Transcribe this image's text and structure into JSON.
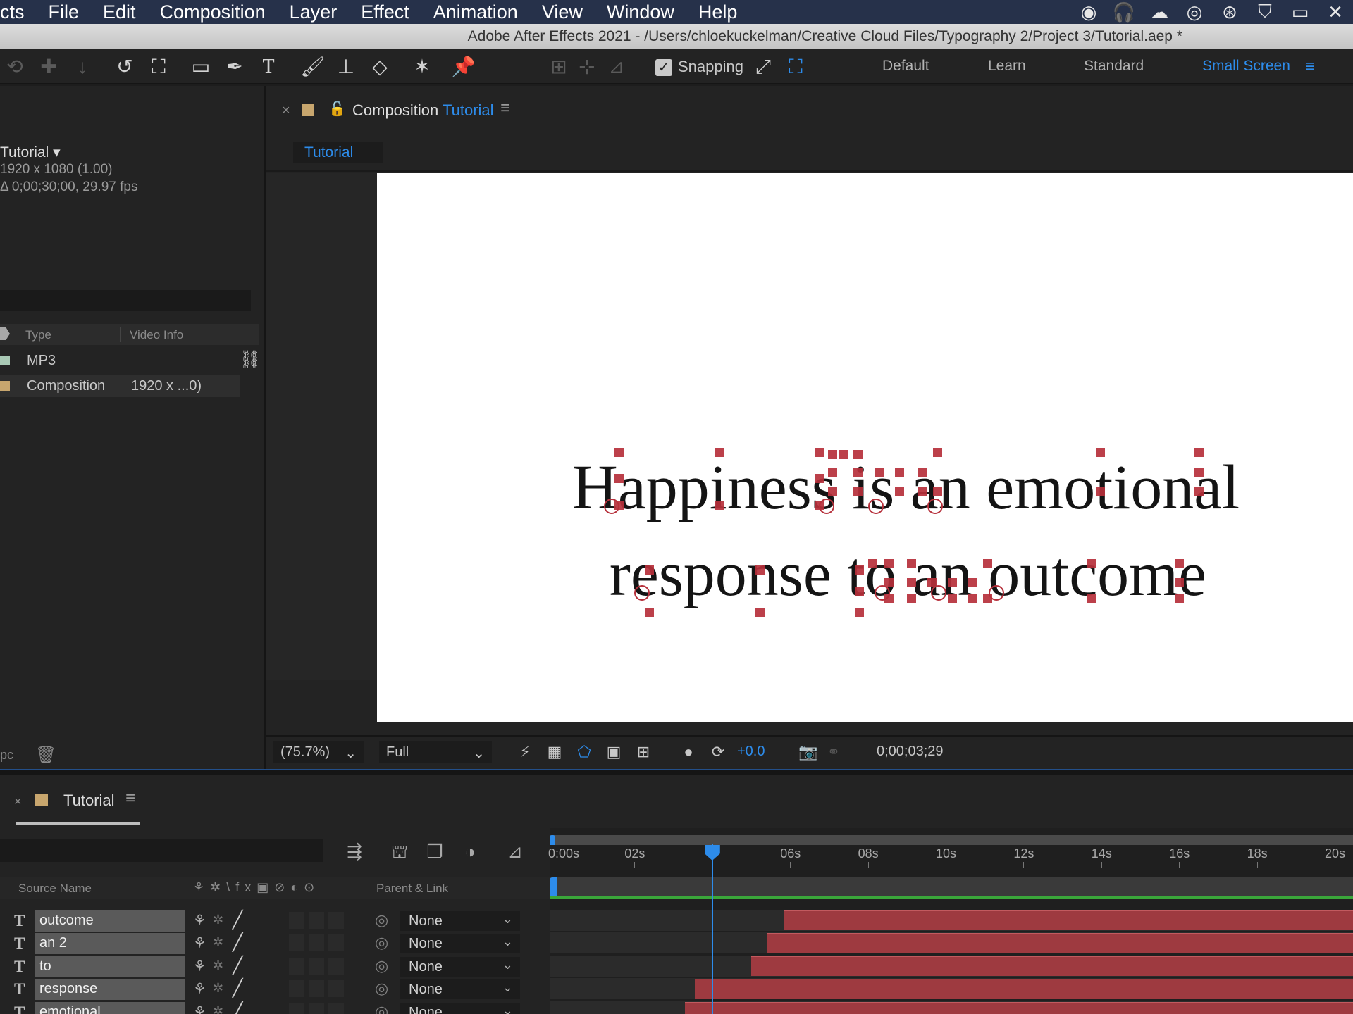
{
  "menubar": {
    "app_name_fragment": "cts",
    "menus": [
      "File",
      "Edit",
      "Composition",
      "Layer",
      "Effect",
      "Animation",
      "View",
      "Window",
      "Help"
    ],
    "tray_icons": [
      "record-icon",
      "headphones-icon",
      "creative-cloud-icon",
      "target-icon",
      "sync-icon",
      "shield-icon",
      "airplay-icon",
      "close-icon"
    ]
  },
  "titlebar": {
    "text": "Adobe After Effects 2021 - /Users/chloekuckelman/Creative Cloud Files/Typography 2/Project 3/Tutorial.aep *"
  },
  "toolbar": {
    "snapping_label": "Snapping",
    "snapping_checked": true,
    "workspaces": [
      "Default",
      "Learn",
      "Standard",
      "Small Screen"
    ],
    "active_workspace": "Small Screen"
  },
  "project": {
    "selected_name": "Tutorial",
    "selected_size": "1920 x 1080 (1.00)",
    "selected_duration": "Δ 0;00;30;00, 29.97 fps",
    "columns": [
      "Type",
      "Video Info"
    ],
    "rows": [
      {
        "type": "MP3",
        "info": "",
        "swatch": "#a8c8b4"
      },
      {
        "type": "Composition",
        "info": "1920 x ...0)",
        "swatch": "#c8a66e"
      }
    ],
    "bpc_label": "pc"
  },
  "composition": {
    "title_prefix": "Composition",
    "title_name": "Tutorial",
    "tab_label": "Tutorial",
    "text_line1": "Happiness is an emotional",
    "text_line2": "response to an outcome",
    "zoom": "(75.7%)",
    "resolution": "Full",
    "exposure": "+0.0",
    "timecode": "0;00;03;29"
  },
  "timeline": {
    "tab_label": "Tutorial",
    "col_source_name": "Source Name",
    "col_switches": "⚘✲\\fx▣⊘◐⊙",
    "col_parent": "Parent & Link",
    "ticks": [
      "0:00s",
      "02s",
      "04s",
      "06s",
      "08s",
      "10s",
      "12s",
      "14s",
      "16s",
      "18s",
      "20s"
    ],
    "current_time_seconds": 4,
    "layers": [
      {
        "name": "outcome",
        "parent": "None",
        "in_point_seconds": 5.85
      },
      {
        "name": "an 2",
        "parent": "None",
        "in_point_seconds": 5.4
      },
      {
        "name": "to",
        "parent": "None",
        "in_point_seconds": 5.0
      },
      {
        "name": "response",
        "parent": "None",
        "in_point_seconds": 3.55
      },
      {
        "name": "emotional",
        "parent": "None",
        "in_point_seconds": 3.3
      }
    ]
  },
  "colors": {
    "accent": "#2d8ceb",
    "layer_bar": "#9e3a40",
    "handle": "#b6303b",
    "panel": "#232323"
  }
}
